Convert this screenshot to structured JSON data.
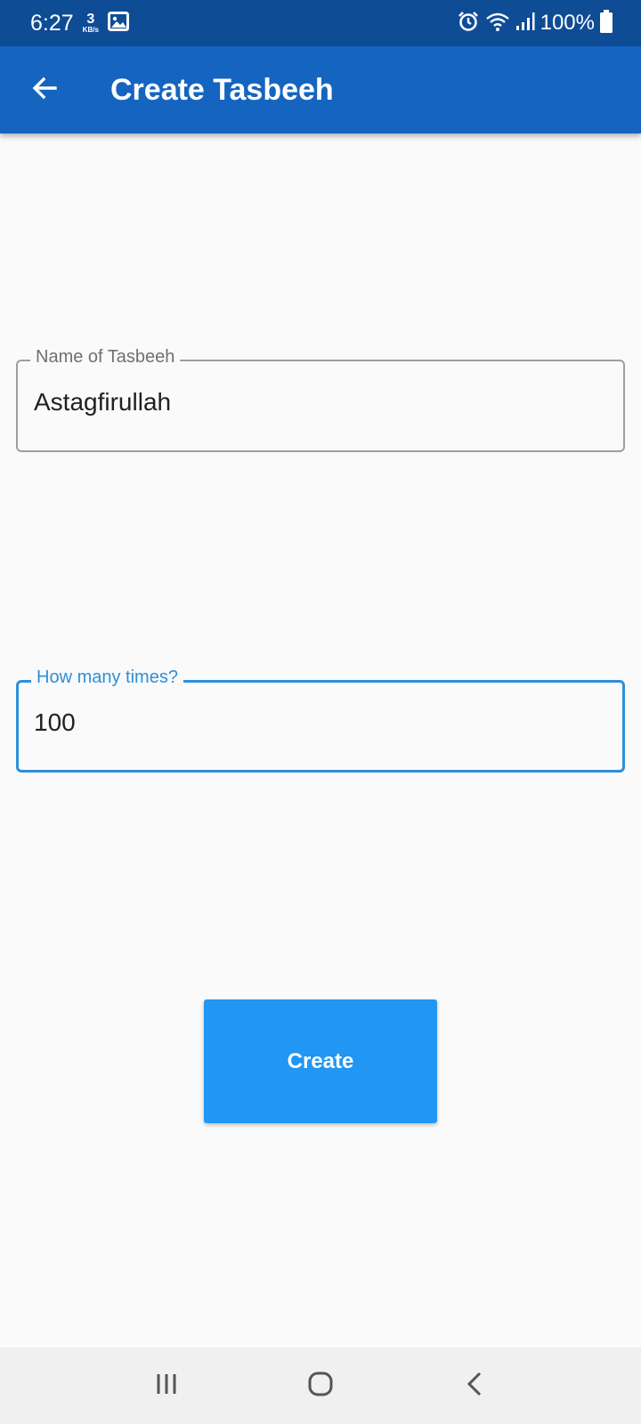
{
  "status_bar": {
    "time": "6:27",
    "net_speed_value": "3",
    "net_speed_unit": "KB/s",
    "battery_percent": "100%",
    "icons": [
      "image-icon",
      "alarm-icon",
      "wifi-icon",
      "signal-icon",
      "battery-icon"
    ]
  },
  "app_bar": {
    "title": "Create Tasbeeh",
    "back_icon": "arrow-back-icon"
  },
  "form": {
    "name_field": {
      "label": "Name of Tasbeeh",
      "value": "Astagfirullah"
    },
    "count_field": {
      "label": "How many times?",
      "value": "100"
    },
    "submit_label": "Create"
  },
  "nav_bar": {
    "icons": [
      "recent-apps-icon",
      "home-icon",
      "back-icon"
    ]
  },
  "colors": {
    "status_bar": "#0f4c96",
    "app_bar": "#1565c0",
    "focus_accent": "#2d8fd9",
    "button": "#2196f3",
    "background": "#fafafa"
  }
}
